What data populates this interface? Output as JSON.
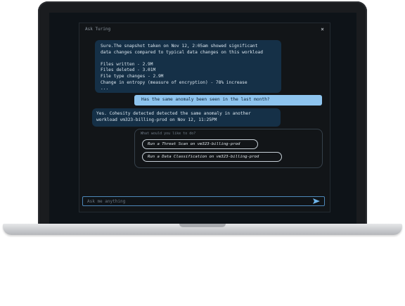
{
  "chat": {
    "title": "Ask Turing",
    "close_glyph": "×"
  },
  "messages": {
    "bot_1": "Sure.The snapshot taken on Nov 12, 2:05am showed significant\ndata changes compared to typical data changes on this workload\n\nFiles written - 2.9M\nFiles deleted - 3.01M\nFile type changes - 2.9M\nChange in entropy (measure of encryption) - 78% increase\n...",
    "user_1": "Has the same anomaly been seen in the last month?",
    "bot_2": "Yes. Cohesity detected detected the same anomaly in another\nworkload vm323-billing-prod on Nov 12, 11:25PM"
  },
  "suggestions": {
    "title": "What would you like to do?",
    "items": [
      "Run a Threat Scan on vm323-billing-prod",
      "Run a Data Classification on vm323-billing-prod"
    ]
  },
  "input": {
    "placeholder": "Ask me anything"
  },
  "colors": {
    "user_bubble": "#8ec4ee",
    "bot_bubble": "#153047",
    "accent": "#4d87b8"
  },
  "icons": {
    "send": "send-icon",
    "close": "close-icon"
  }
}
